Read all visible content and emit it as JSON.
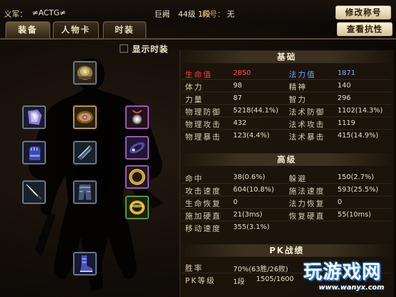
{
  "window": {
    "top_title": "",
    "guild_label": "义军：",
    "guild_value": "≠ACTG≠",
    "player_name": "巨阙",
    "player_level": "44级 1段",
    "title_label": "称号：",
    "title_value": "无"
  },
  "buttons": {
    "modify_title": "修改称号",
    "view_resistance": "查看抗性"
  },
  "tabs": [
    {
      "label": "装备",
      "active": true
    },
    {
      "label": "人物卡",
      "active": false
    },
    {
      "label": "时装",
      "active": false
    }
  ],
  "options": {
    "show_fashion": "显示时装",
    "show_fashion_checked": false
  },
  "equipment": [
    {
      "name": "helmet-icon"
    },
    {
      "name": "armor-icon"
    },
    {
      "name": "necklace-icon"
    },
    {
      "name": "glove-icon"
    },
    {
      "name": "bracer-icon"
    },
    {
      "name": "ring-icon"
    },
    {
      "name": "dagger-icon"
    },
    {
      "name": "greaves-icon"
    },
    {
      "name": "ring-icon"
    },
    {
      "name": "ring-icon"
    },
    {
      "name": "boots-icon"
    }
  ],
  "basic": {
    "header": "基础",
    "rows": [
      {
        "l1": "生命值",
        "v1": "2850",
        "l2": "法力值",
        "v2": "1871"
      },
      {
        "l1": "体力",
        "v1": "98",
        "l2": "精神",
        "v2": "140"
      },
      {
        "l1": "力量",
        "v1": "87",
        "l2": "智力",
        "v2": "296"
      },
      {
        "l1": "物理防御",
        "v1": "5218(44.1%)",
        "l2": "法术防御",
        "v2": "1102(14.3%)"
      },
      {
        "l1": "物理攻击",
        "v1": "432",
        "l2": "法术攻击",
        "v2": "1119"
      },
      {
        "l1": "物理暴击",
        "v1": "123(4.4%)",
        "l2": "法术暴击",
        "v2": "415(14.9%)"
      }
    ]
  },
  "advanced": {
    "header": "高级",
    "rows": [
      {
        "l1": "命中",
        "v1": "38(0.6%)",
        "l2": "躲避",
        "v2": "150(2.7%)"
      },
      {
        "l1": "攻击速度",
        "v1": "604(10.8%)",
        "l2": "施法速度",
        "v2": "593(25.5%)"
      },
      {
        "l1": "生命恢复",
        "v1": "0",
        "l2": "法力恢复",
        "v2": "0"
      },
      {
        "l1": "施加硬直",
        "v1": "21(3ms)",
        "l2": "恢复硬直",
        "v2": "55(10ms)"
      },
      {
        "l1": "移动速度",
        "v1": "355(3.1%)",
        "l2": "",
        "v2": ""
      }
    ]
  },
  "pk": {
    "header": "PK战绩",
    "win_label": "胜率",
    "win_value": "70%(63胜/26败)",
    "rank_label": "PK等级",
    "rank_level": "1段",
    "rank_points": "1505/1600"
  },
  "watermark": {
    "title": "玩游戏网",
    "url": "www.wanyx.com"
  }
}
